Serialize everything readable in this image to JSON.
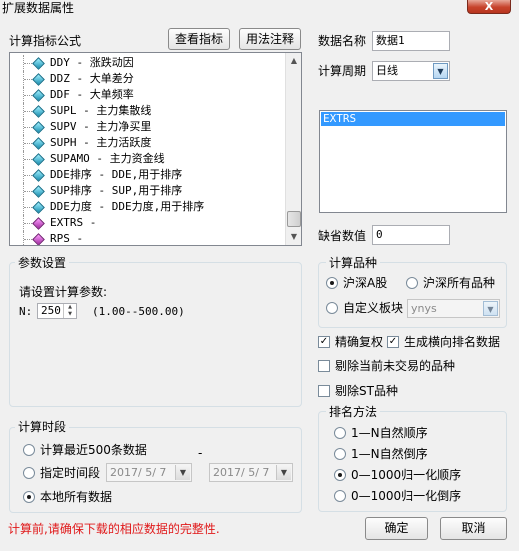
{
  "window": {
    "title": "扩展数据属性",
    "close_glyph": "X"
  },
  "formula": {
    "label": "计算指标公式",
    "view_button": "查看指标",
    "usage_button": "用法注释",
    "items": [
      {
        "text": "DDY - 涨跌动因",
        "icon": "blue"
      },
      {
        "text": "DDZ - 大单差分",
        "icon": "blue"
      },
      {
        "text": "DDF - 大单频率",
        "icon": "blue"
      },
      {
        "text": "SUPL - 主力集散线",
        "icon": "blue"
      },
      {
        "text": "SUPV - 主力净买里",
        "icon": "blue"
      },
      {
        "text": "SUPH - 主力活跃度",
        "icon": "blue"
      },
      {
        "text": "SUPAMO - 主力资金线",
        "icon": "blue"
      },
      {
        "text": "DDE排序 - DDE,用于排序",
        "icon": "blue"
      },
      {
        "text": "SUP排序 - SUP,用于排序",
        "icon": "blue"
      },
      {
        "text": "DDE力度 - DDE力度,用于排序",
        "icon": "blue"
      },
      {
        "text": "EXTRS -",
        "icon": "magenta"
      },
      {
        "text": "RPS -",
        "icon": "magenta"
      }
    ],
    "scroll_up": "▲",
    "scroll_down": "▼"
  },
  "data_name": {
    "label": "数据名称",
    "value": "数据1"
  },
  "period": {
    "label": "计算周期",
    "value": "日线",
    "arrow": "▼"
  },
  "data_list": {
    "selected": "EXTRS"
  },
  "default_value": {
    "label": "缺省数值",
    "value": "0"
  },
  "params": {
    "group_title": "参数设置",
    "prompt": "请设置计算参数:",
    "n_label": "N:",
    "n_value": "250",
    "range": "(1.00--500.00)"
  },
  "calc_range": {
    "group_title": "计算时段",
    "option_recent": "计算最近500条数据",
    "dash": "-",
    "option_period": "指定时间段",
    "start_date": "2017/ 5/ 7",
    "end_date": "2017/ 5/ 7",
    "option_all": "本地所有数据",
    "selected": "all"
  },
  "variety": {
    "group_title": "计算品种",
    "option_sh_a": "沪深A股",
    "option_all": "沪深所有品种",
    "option_custom": "自定义板块",
    "custom_value": "ynys",
    "selected": "sh_a"
  },
  "options": {
    "precise_fq": "精确复权",
    "precise_fq_checked": true,
    "gen_rank": "生成横向排名数据",
    "gen_rank_checked": true,
    "exclude_untraded": "剔除当前未交易的品种",
    "exclude_untraded_checked": false,
    "exclude_st": "剔除ST品种",
    "exclude_st_checked": false,
    "check_glyph": "✓"
  },
  "rank": {
    "group_title": "排名方法",
    "opt1": "1—N自然顺序",
    "opt2": "1—N自然倒序",
    "opt3": "0—1000归一化顺序",
    "opt4": "0—1000归一化倒序",
    "selected": 3
  },
  "footer": {
    "warning": "计算前,请确保下载的相应数据的完整性.",
    "ok": "确定",
    "cancel": "取消"
  },
  "colors": {
    "warning": "#e0191a",
    "selection": "#3399ff"
  }
}
